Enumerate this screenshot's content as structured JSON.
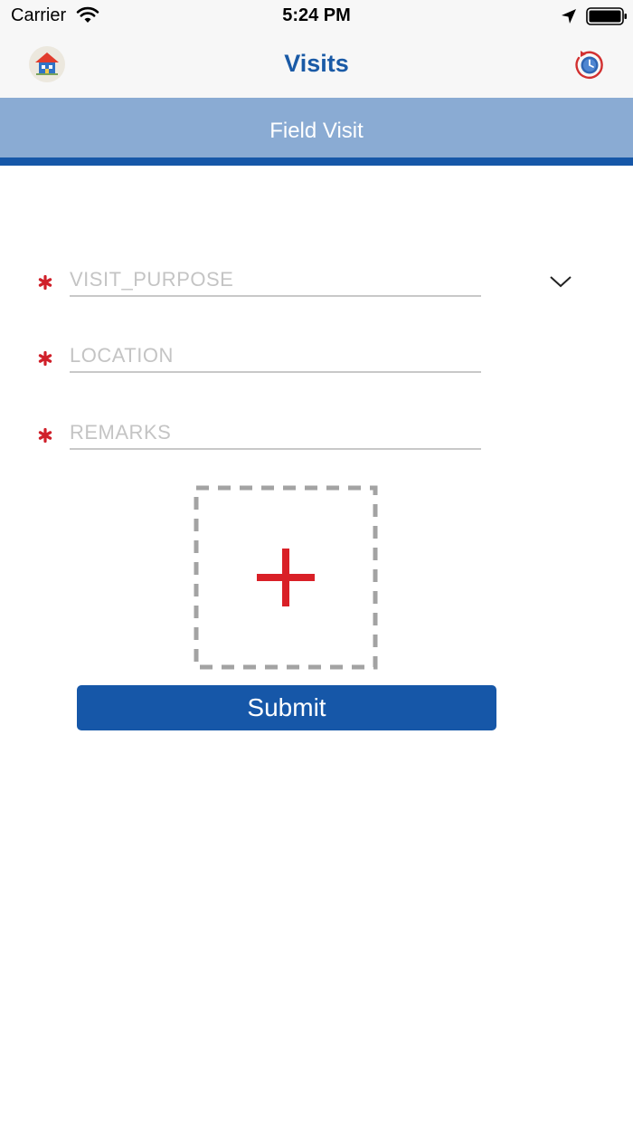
{
  "status_bar": {
    "carrier": "Carrier",
    "time": "5:24 PM"
  },
  "nav": {
    "title": "Visits",
    "left_icon": "home-icon",
    "right_icon": "history-clock-icon"
  },
  "section": {
    "title": "Field Visit"
  },
  "form": {
    "fields": [
      {
        "placeholder": "VISIT_PURPOSE",
        "value": "",
        "type": "dropdown",
        "required": true
      },
      {
        "placeholder": "LOCATION",
        "value": "",
        "type": "text",
        "required": true
      },
      {
        "placeholder": "REMARKS",
        "value": "",
        "type": "text",
        "required": true
      }
    ],
    "add_photo_icon": "plus-icon",
    "submit_label": "Submit"
  },
  "colors": {
    "brand_blue": "#1657a8",
    "header_light_blue": "#8aabd3",
    "required_red": "#d0202a",
    "placeholder_gray": "#c4c4c4"
  }
}
